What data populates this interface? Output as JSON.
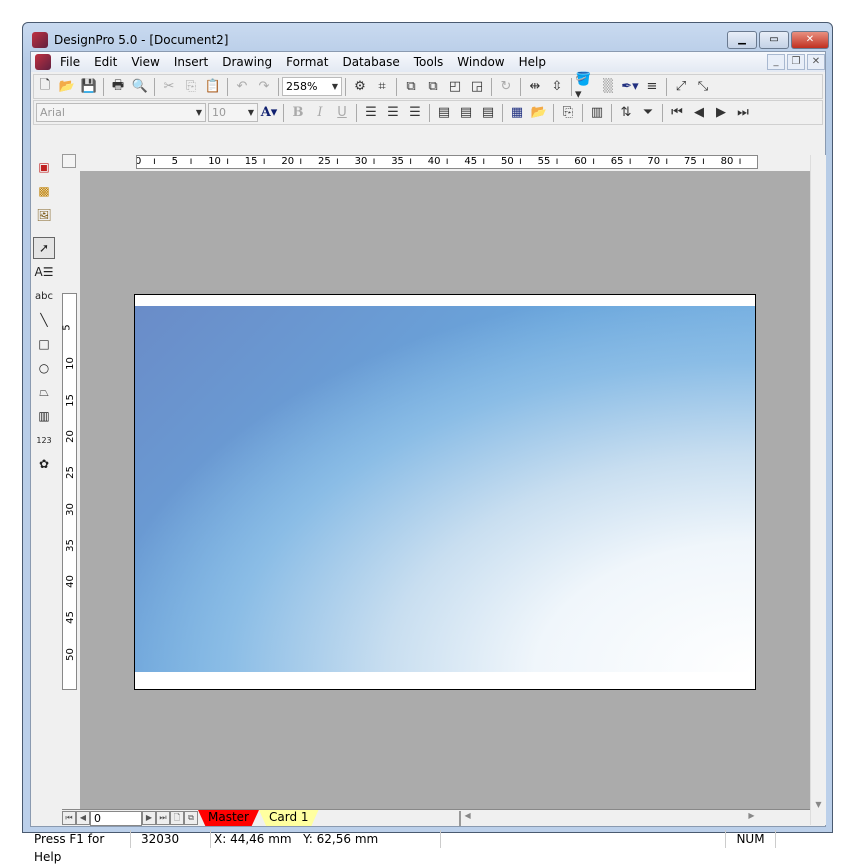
{
  "window": {
    "title": "DesignPro 5.0 - [Document2]"
  },
  "menu": [
    "File",
    "Edit",
    "View",
    "Insert",
    "Drawing",
    "Format",
    "Database",
    "Tools",
    "Window",
    "Help"
  ],
  "toolbar": {
    "zoom": "258%"
  },
  "format_toolbar": {
    "font": "Arial",
    "size": "10",
    "bold": "B",
    "italic": "I",
    "underline": "U",
    "font_color": "A"
  },
  "ruler_h": [
    "0",
    "5",
    "10",
    "15",
    "20",
    "25",
    "30",
    "35",
    "40",
    "45",
    "50",
    "55",
    "60",
    "65",
    "70",
    "75",
    "80",
    "8"
  ],
  "ruler_v": [
    "5",
    "10",
    "15",
    "20",
    "25",
    "30",
    "35",
    "40",
    "45",
    "50"
  ],
  "pages": {
    "current": "0",
    "tabs": [
      {
        "label": "Master",
        "color": "#ff0000"
      },
      {
        "label": "Card 1",
        "color": "#ffffa0"
      }
    ]
  },
  "status": {
    "help": "Press F1 for Help",
    "code": "32030",
    "coords": "X: 44,46 mm   Y: 62,56 mm",
    "num": "NUM"
  }
}
